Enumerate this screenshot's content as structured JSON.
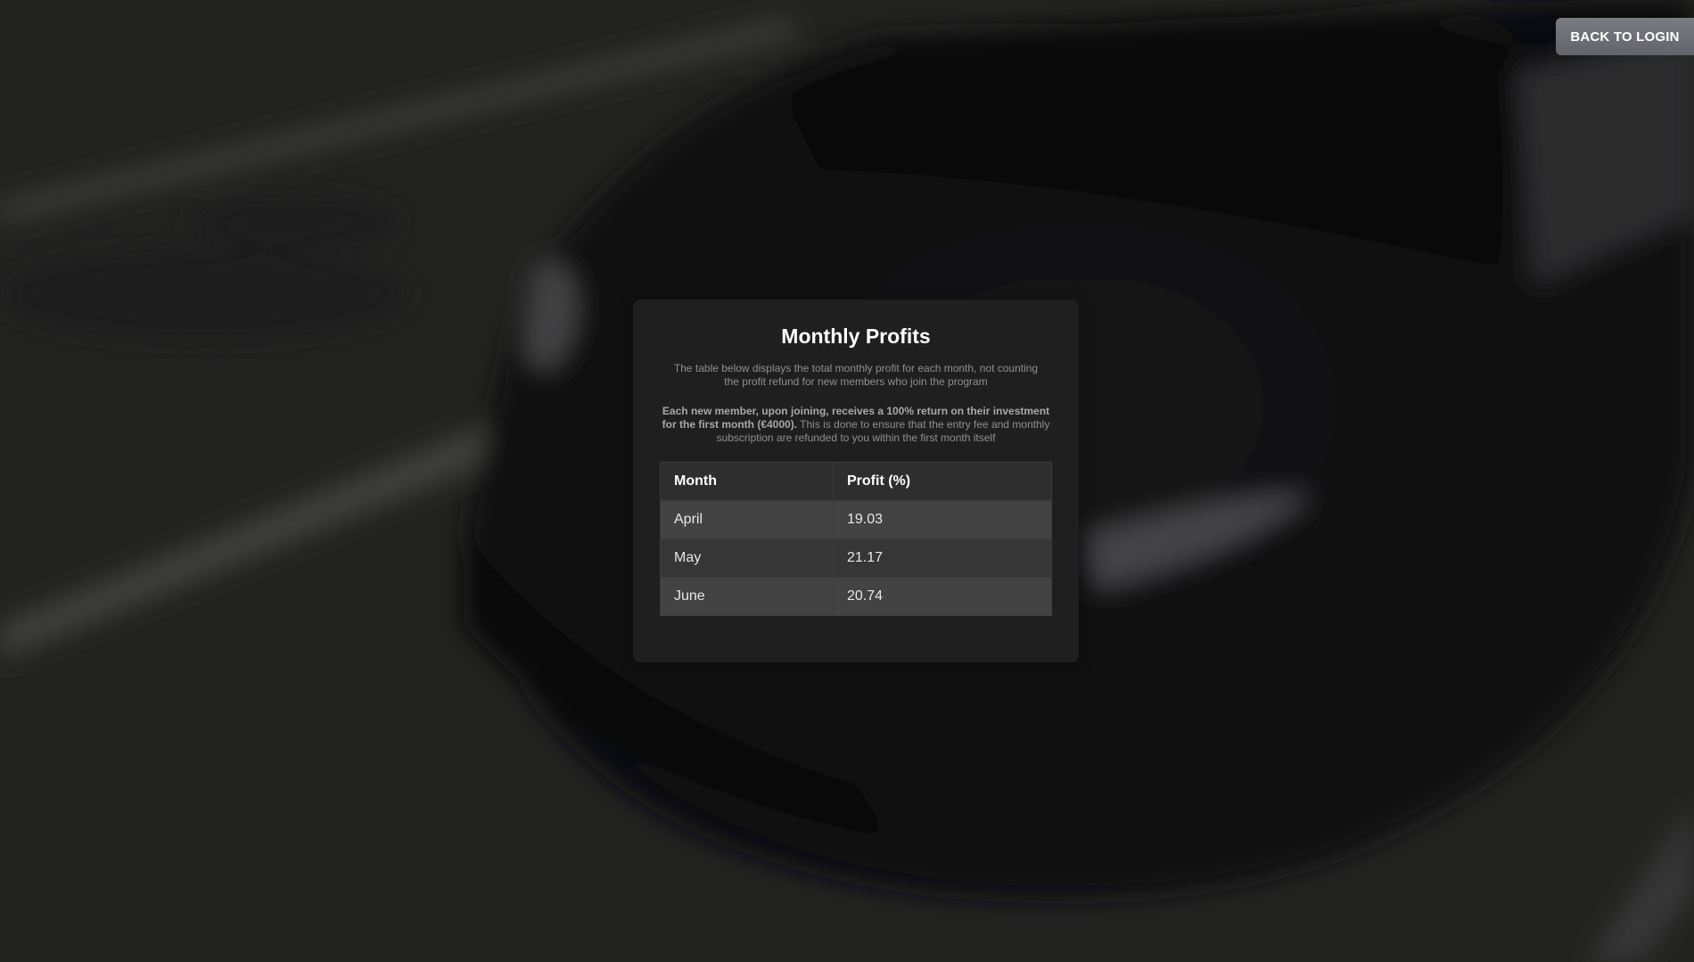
{
  "header": {
    "back_button_label": "BACK TO LOGIN"
  },
  "card": {
    "title": "Monthly Profits",
    "description": "The table below displays the total monthly profit for each month, not counting the profit refund for new members who join the program",
    "note_bold": "Each new member, upon joining, receives a 100% return on their investment for the first month (€4000).",
    "note_rest": " This is done to ensure that the entry fee and monthly subscription are refunded to you within the first month itself"
  },
  "table": {
    "columns": [
      "Month",
      "Profit (%)"
    ],
    "rows": [
      {
        "month": "April",
        "profit": "19.03"
      },
      {
        "month": "May",
        "profit": "21.17"
      },
      {
        "month": "June",
        "profit": "20.74"
      }
    ]
  },
  "colors": {
    "card_background": "#1f1f1f",
    "header_row": "#2e2e2e",
    "row_odd": "#434343",
    "row_even": "#363636",
    "button": "#6f6f77"
  }
}
